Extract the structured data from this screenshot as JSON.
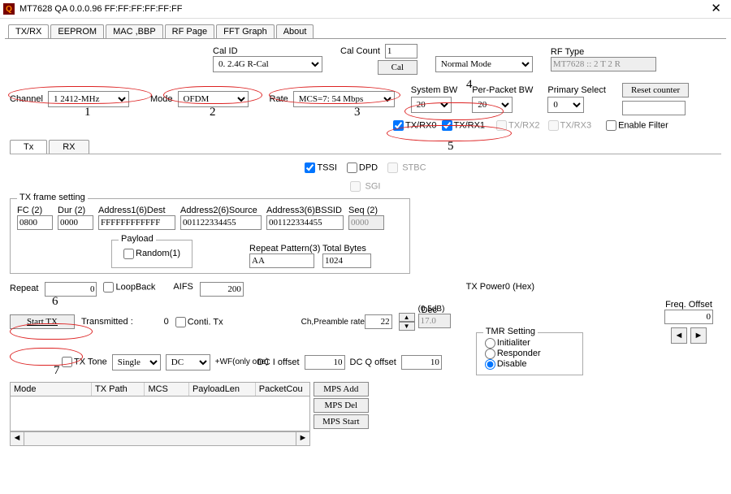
{
  "title": "MT7628 QA 0.0.0.96     FF:FF:FF:FF:FF:FF",
  "tabs": {
    "main": [
      "TX/RX",
      "EEPROM",
      "MAC ,BBP",
      "RF Page",
      "FFT Graph",
      "About"
    ],
    "txrx": [
      "Tx",
      "RX"
    ]
  },
  "calid_label": "Cal ID",
  "calid_value": "0. 2.4G R-Cal",
  "calcount_label": "Cal Count",
  "calcount_value": "1",
  "cal_btn": "Cal",
  "mode_sel": "Normal Mode",
  "rftype_label": "RF Type",
  "rftype_value": "MT7628 :: 2 T 2 R",
  "channel_label": "Channel",
  "channel_value": "1 2412-MHz",
  "mode_label": "Mode",
  "mode_value": "OFDM",
  "rate_label": "Rate",
  "rate_value": "MCS=7: 54 Mbps",
  "sysbw_label": "System BW",
  "sysbw_value": "20",
  "ppbw_label": "Per-Packet BW",
  "ppbw_value": "20",
  "prim_label": "Primary Select",
  "prim_value": "0",
  "reset_btn": "Reset counter",
  "enfilter": "Enable Filter",
  "txrx0": "TX/RX0",
  "txrx1": "TX/RX1",
  "txrx2": "TX/RX2",
  "txrx3": "TX/RX3",
  "tssi": "TSSI",
  "dpd": "DPD",
  "stbc": " STBC",
  "sgi": " SGI",
  "frame": {
    "legend": "TX frame setting",
    "fc_l": "FC (2)",
    "fc": "0800",
    "dur_l": "Dur (2)",
    "dur": "0000",
    "a1_l": "Address1(6)Dest",
    "a1": "FFFFFFFFFFFF",
    "a2_l": "Address2(6)Source",
    "a2": "001122334455",
    "a3_l": "Address3(6)BSSID",
    "a3": "001122334455",
    "seq_l": "Seq (2)",
    "seq": "0000",
    "pl_legend": "Payload",
    "random": "Random(1)",
    "rp_l": "Repeat Pattern(3)",
    "rp": "AA",
    "tb_l": "Total Bytes",
    "tb": "1024"
  },
  "repeat_l": "Repeat",
  "repeat": "0",
  "loopback": "LoopBack",
  "aifs_l": "AIFS",
  "aifs": "200",
  "start_btn": "Start TX",
  "transmitted_l": "Transmitted :",
  "transmitted": "0",
  "conti": "Conti. Tx",
  "txtone": "TX Tone",
  "tone_sel": "Single",
  "dc_sel": "DC",
  "wf": "+WF(only one)",
  "chpre": "Ch,Preamble rateTXPath",
  "chpre_v": "22",
  "chpre_step": "0.5dB",
  "dec_l": "Dec",
  "dec": "17.0",
  "txpow_l": "TX Power0 (Hex)",
  "dci_l": "DC I offset",
  "dci": "10",
  "dcq_l": "DC Q offset",
  "dcq": "10",
  "freq_l": "Freq. Offset",
  "freq": "0",
  "tmr": {
    "legend": "TMR Setting",
    "init": "Initialiter",
    "resp": "Responder",
    "dis": "Disable"
  },
  "cols": {
    "mode": "Mode",
    "txp": "TX Path",
    "mcs": "MCS",
    "pl": "PayloadLen",
    "pc": "PacketCou"
  },
  "mps": {
    "add": "MPS Add",
    "del": "MPS Del",
    "start": "MPS Start"
  },
  "ann": {
    "n1": "1",
    "n2": "2",
    "n3": "3",
    "n4": "4",
    "n5": "5",
    "n6": "6",
    "n7": "7"
  }
}
